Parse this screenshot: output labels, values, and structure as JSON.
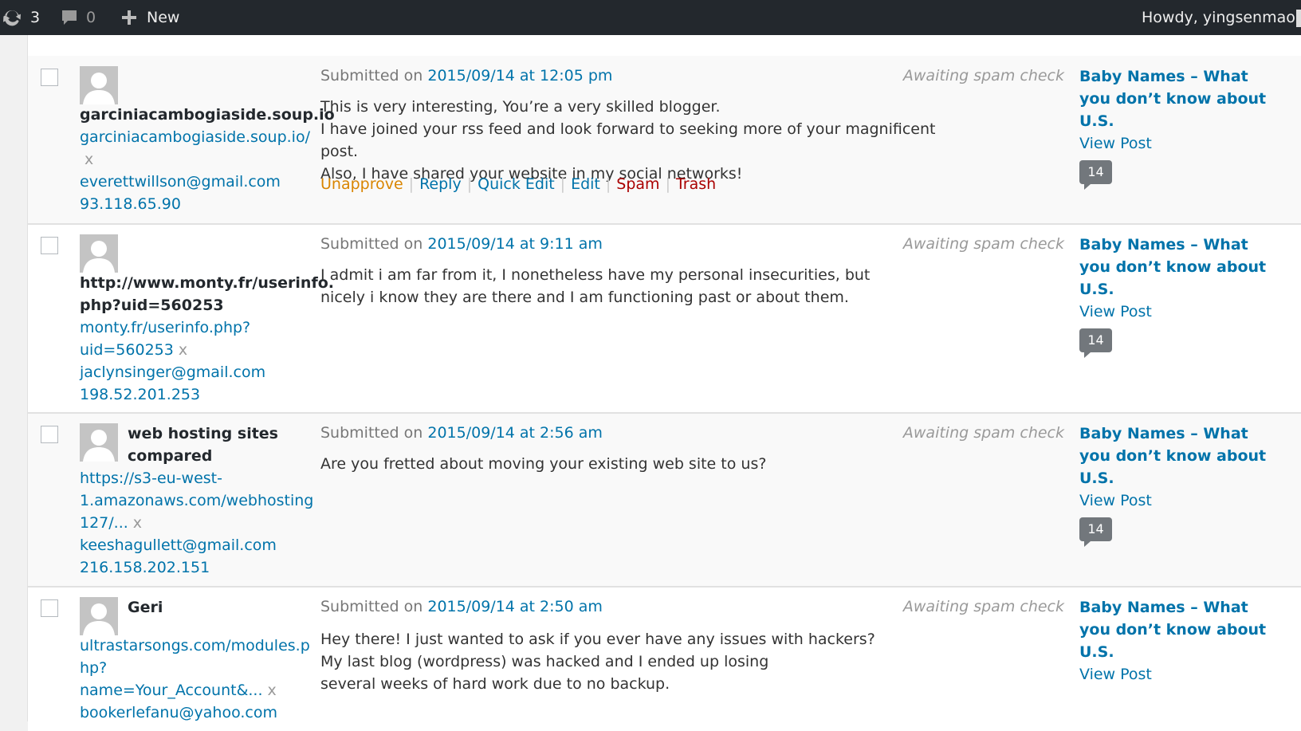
{
  "adminbar": {
    "updates_count": "3",
    "comments_count": "0",
    "new_label": "New",
    "howdy": "Howdy, yingsenmao"
  },
  "labels": {
    "submitted_on": "Submitted on",
    "awaiting": "Awaiting spam check",
    "view_post": "View Post",
    "remove_x": "x"
  },
  "actions": {
    "unapprove": "Unapprove",
    "reply": "Reply",
    "quick_edit": "Quick Edit",
    "edit": "Edit",
    "spam": "Spam",
    "trash": "Trash"
  },
  "comments": [
    {
      "author_name": "garciniacambogiaside.soup.io",
      "author_url": "garciniacambogiaside.soup.io/",
      "email": "everettwillson@gmail.com",
      "ip": "93.118.65.90",
      "date": "2015/09/14 at 12:05 pm",
      "lines": [
        "This is very interesting, You’re a very skilled blogger.",
        "I have joined your rss feed and look forward to seeking more of your magnificent post.",
        "Also, I have shared your website in my social networks!"
      ],
      "post_title_1": "Baby Names – What",
      "post_title_2": "you don’t know about",
      "post_title_3": "U.S.",
      "count": "14"
    },
    {
      "author_name_1": "http://www.monty.fr/userinfo.",
      "author_name_2": "php?uid=560253",
      "author_url_1": "monty.fr/userinfo.php?",
      "author_url_2": "uid=560253",
      "email": "jaclynsinger@gmail.com",
      "ip": "198.52.201.253",
      "date": "2015/09/14 at 9:11 am",
      "lines": [
        "I admit i am far from it, I nonetheless have my personal insecurities, but",
        "nicely i know they are there and I am functioning past or about them."
      ],
      "post_title_1": "Baby Names – What",
      "post_title_2": "you don’t know about",
      "post_title_3": "U.S.",
      "count": "14"
    },
    {
      "author_name_1": "web hosting sites",
      "author_name_2": "compared",
      "author_url_1": "https://s3-eu-west-",
      "author_url_2": "1.amazonaws.com/webhosting",
      "author_url_3": "127/...",
      "email": "keeshagullett@gmail.com",
      "ip": "216.158.202.151",
      "date": "2015/09/14 at 2:56 am",
      "lines": [
        "Are you fretted about moving your existing web site to us?"
      ],
      "post_title_1": "Baby Names – What",
      "post_title_2": "you don’t know about",
      "post_title_3": "U.S.",
      "count": "14"
    },
    {
      "author_name": "Geri",
      "author_url_1": "ultrastarsongs.com/modules.p",
      "author_url_2": "hp?name=Your_Account&...",
      "email": "bookerlefanu@yahoo.com",
      "date": "2015/09/14 at 2:50 am",
      "lines": [
        "Hey there! I just wanted to ask if you ever have any issues with hackers?",
        "My last blog (wordpress) was hacked and I ended up losing",
        "several weeks of hard work due to no backup."
      ],
      "post_title_1": "Baby Names – What",
      "post_title_2": "you don’t know about",
      "post_title_3": "U.S."
    }
  ]
}
